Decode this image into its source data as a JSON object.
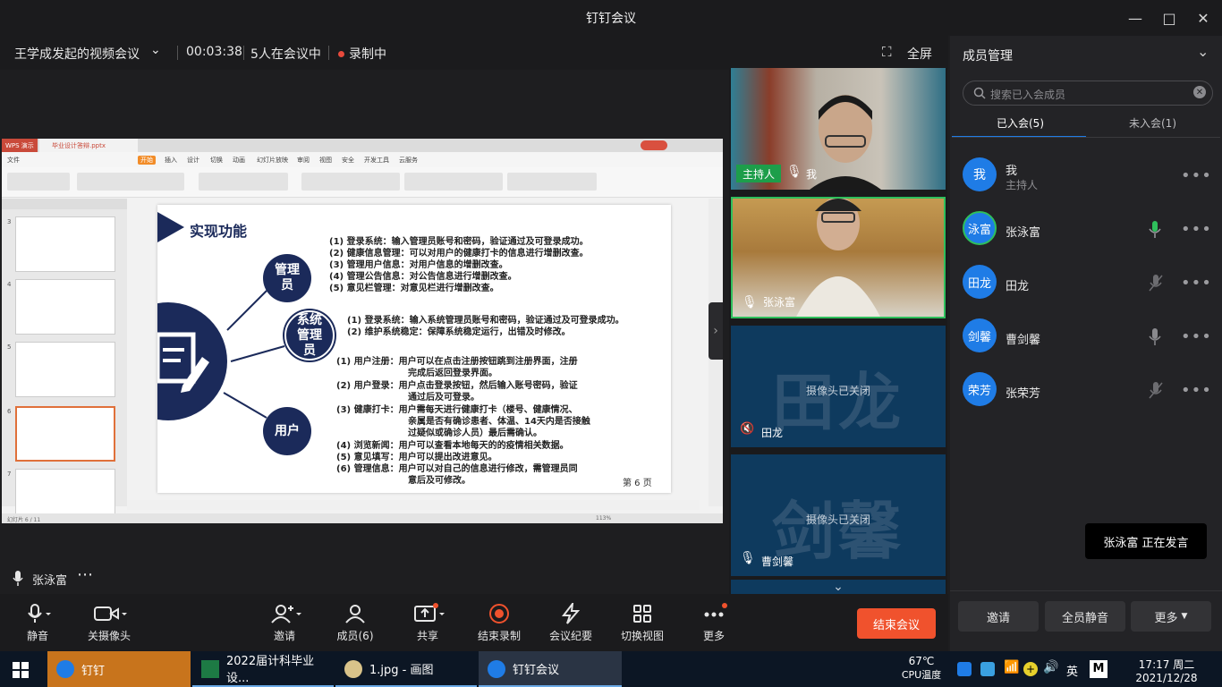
{
  "window": {
    "title": "钉钉会议"
  },
  "meeting": {
    "name": "王学成发起的视频会议",
    "elapsed": "00:03:38",
    "participants": "5人在会议中",
    "recording": "录制中",
    "fullscreen": "全屏"
  },
  "wps": {
    "app_tab": "WPS 演示",
    "file_tab": "毕业设计答辩.pptx",
    "menu": [
      "文件",
      "开始",
      "插入",
      "设计",
      "切换",
      "动画",
      "幻灯片放映",
      "审阅",
      "视图",
      "安全",
      "开发工具",
      "云服务"
    ],
    "status": "幻灯片 6 / 11",
    "zoom": "113%",
    "page": "第 6 页"
  },
  "slide": {
    "title": "实现功能",
    "roles": [
      "管理员",
      "系统管理员",
      "用户"
    ],
    "admin_lines": [
      "(1) 登录系统：输入管理员账号和密码，验证通过及可登录成功。",
      "(2) 健康信息管理：可以对用户的健康打卡的信息进行增删改查。",
      "(3) 管理用户信息：对用户信息的增删改查。",
      "(4) 管理公告信息：对公告信息进行增删改查。",
      "(5) 意见栏管理：对意见栏进行增删改查。"
    ],
    "sysadmin_lines": [
      "(1) 登录系统：输入系统管理员账号和密码，验证通过及可登录成功。",
      "(2) 维护系统稳定：保障系统稳定运行，出错及时修改。"
    ],
    "user_lines": [
      "(1) 用户注册：用户可以在点击注册按钮跳到注册界面，注册",
      "完成后返回登录界面。",
      "(2) 用户登录：用户点击登录按钮，然后输入账号密码，验证",
      "通过后及可登录。",
      "(3) 健康打卡：用户需每天进行健康打卡（楼号、健康情况、",
      "亲属是否有确诊患者、体温、14天内是否接触",
      "过疑似或确诊人员）最后需确认。",
      "(4) 浏览新闻：用户可以查看本地每天的的疫情相关数据。",
      "(5) 意见填写：用户可以提出改进意见。",
      "(6) 管理信息：用户可以对自己的信息进行修改，需管理员同",
      "意后及可修改。"
    ]
  },
  "self": {
    "name": "张泳富"
  },
  "toolbar": {
    "mute": "静音",
    "camera": "关摄像头",
    "invite": "邀请",
    "members": "成员(6)",
    "share": "共享",
    "stop_record": "结束录制",
    "minutes": "会议纪要",
    "switch_view": "切换视图",
    "more": "更多",
    "end": "结束会议"
  },
  "videos": [
    {
      "badge": "主持人",
      "name": "我"
    },
    {
      "name": "张泳富"
    },
    {
      "name": "田龙",
      "bg": "田龙",
      "status": "摄像头已关闭"
    },
    {
      "name": "曹剑馨",
      "bg": "剑馨",
      "status": "摄像头已关闭"
    }
  ],
  "panel": {
    "title": "成员管理",
    "search_placeholder": "搜索已入会成员",
    "tab_joined": "已入会(5)",
    "tab_not_joined": "未入会(1)",
    "members": [
      {
        "avatar": "我",
        "name": "我",
        "role": "主持人"
      },
      {
        "avatar": "泳富",
        "name": "张泳富"
      },
      {
        "avatar": "田龙",
        "name": "田龙"
      },
      {
        "avatar": "剑馨",
        "name": "曹剑馨"
      },
      {
        "avatar": "荣芳",
        "name": "张荣芳"
      }
    ],
    "invite": "邀请",
    "mute_all": "全员静音",
    "more": "更多"
  },
  "speaking": {
    "text": "张泳富  正在发言"
  },
  "taskbar": {
    "apps": [
      "钉钉",
      "2022届计科毕业设...",
      "1.jpg - 画图",
      "钉钉会议"
    ],
    "cpu_temp": "67℃",
    "cpu_label": "CPU温度",
    "ime": "英",
    "time": "17:17 周二",
    "date": "2021/12/28"
  },
  "colors": {
    "accent": "#1f7ce6",
    "end": "#f0522d",
    "active_border": "#2fbf5c",
    "slide_navy": "#1b2a5a"
  }
}
